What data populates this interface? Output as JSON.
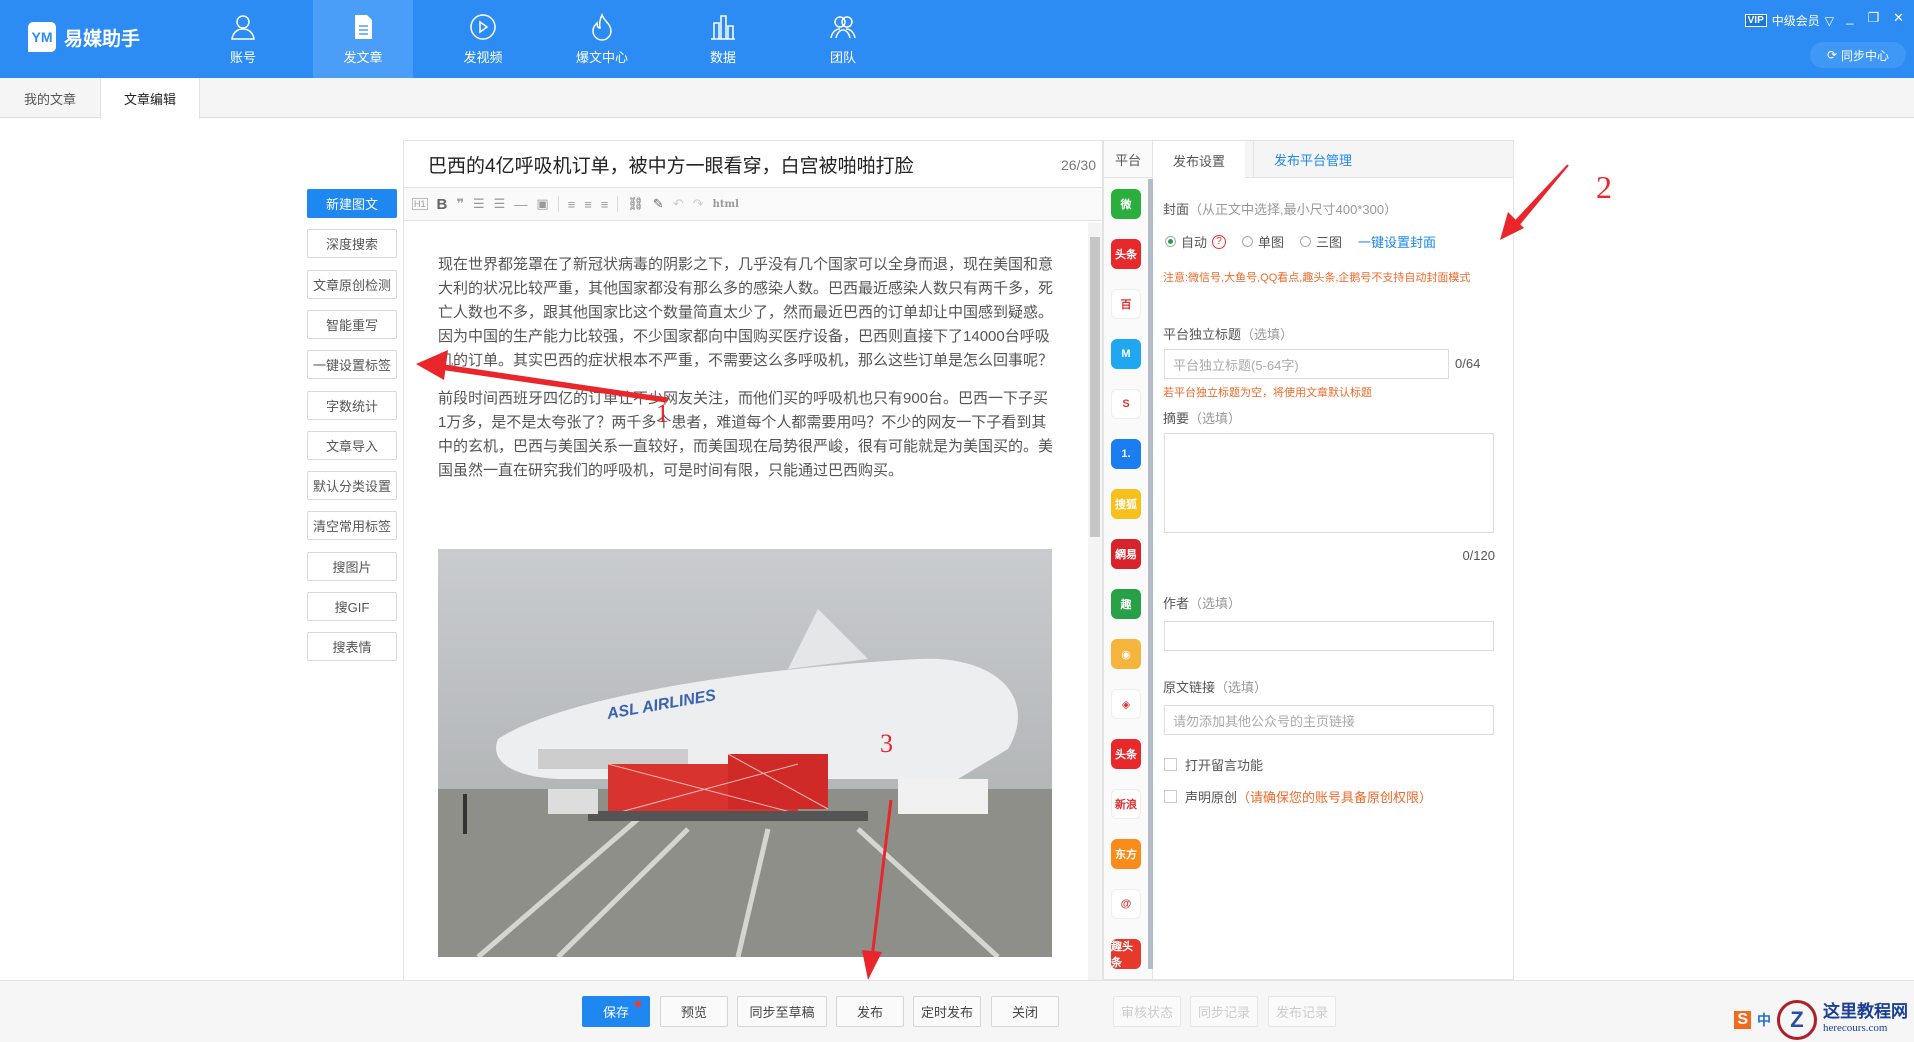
{
  "app": {
    "name": "易媒助手",
    "vip_badge": "VIP",
    "member_level": "中级会员",
    "sync_center": "同步中心"
  },
  "nav": [
    {
      "label": "账号",
      "icon": "user-icon"
    },
    {
      "label": "发文章",
      "icon": "document-icon",
      "active": true
    },
    {
      "label": "发视频",
      "icon": "play-icon"
    },
    {
      "label": "爆文中心",
      "icon": "flame-icon"
    },
    {
      "label": "数据",
      "icon": "bar-chart-icon"
    },
    {
      "label": "团队",
      "icon": "team-icon"
    }
  ],
  "tabs": [
    {
      "label": "我的文章"
    },
    {
      "label": "文章编辑",
      "active": true
    }
  ],
  "tools": [
    "新建图文",
    "深度搜索",
    "文章原创检测",
    "智能重写",
    "一键设置标签",
    "字数统计",
    "文章导入",
    "默认分类设置",
    "清空常用标签",
    "搜图片",
    "搜GIF",
    "搜表情"
  ],
  "editor": {
    "title": "巴西的4亿呼吸机订单，被中方一眼看穿，白宫被啪啪打脸",
    "title_count": "26/30",
    "toolbar_html": "html",
    "paragraphs": [
      "现在世界都笼罩在了新冠状病毒的阴影之下，几乎没有几个国家可以全身而退，现在美国和意大利的状况比较严重，其他国家都没有那么多的感染人数。巴西最近感染人数只有两千多，死亡人数也不多，跟其他国家比这个数量简直太少了，然而最近巴西的订单却让中国感到疑惑。因为中国的生产能力比较强，不少国家都向中国购买医疗设备，巴西则直接下了14000台呼吸机的订单。其实巴西的症状根本不严重，不需要这么多呼吸机，那么这些订单是怎么回事呢？",
      "前段时间西班牙四亿的订单让不少网友关注，而他们买的呼吸机也只有900台。巴西一下子买1万多，是不是太夸张了？两千多个患者，难道每个人都需要用吗？不少的网友一下子看到其中的玄机，巴西与美国关系一直较好，而美国现在局势很严峻，很有可能就是为美国买的。美国虽然一直在研究我们的呼吸机，可是时间有限，只能通过巴西购买。"
    ],
    "image_text": "ASL AIRLINES"
  },
  "platform": {
    "header": "平台",
    "icons": [
      {
        "name": "wechat",
        "glyph": "微",
        "color": "#2aae3d"
      },
      {
        "name": "toutiao",
        "glyph": "头条",
        "color": "#e8292b"
      },
      {
        "name": "baijiahao",
        "glyph": "百",
        "color": "#ffffff"
      },
      {
        "name": "dayu",
        "glyph": "M",
        "color": "#1fa8f0"
      },
      {
        "name": "qiehao",
        "glyph": "S",
        "color": "#ffffff"
      },
      {
        "name": "yidian",
        "glyph": "1.",
        "color": "#1a7ef0"
      },
      {
        "name": "sohu",
        "glyph": "搜狐",
        "color": "#f7c01a"
      },
      {
        "name": "netease",
        "glyph": "網易",
        "color": "#d9232c"
      },
      {
        "name": "qutoutiao",
        "glyph": "趣",
        "color": "#27a046"
      },
      {
        "name": "weibo",
        "glyph": "◉",
        "color": "#f5b53d"
      },
      {
        "name": "aiqiyi",
        "glyph": "◈",
        "color": "#ffffff"
      },
      {
        "name": "toutiao-2",
        "glyph": "头条",
        "color": "#e8292b"
      },
      {
        "name": "sina-kandian",
        "glyph": "新浪",
        "color": "#ffffff"
      },
      {
        "name": "dongfang",
        "glyph": "东方",
        "color": "#f98b1b"
      },
      {
        "name": "fenghuang",
        "glyph": "@",
        "color": "#ffffff"
      },
      {
        "name": "qutoutiao-2",
        "glyph": "趣头条",
        "color": "#e6382b"
      }
    ]
  },
  "settings": {
    "tabs": [
      "发布设置",
      "发布平台管理"
    ],
    "cover_label": "封面",
    "cover_hint": "（从正文中选择,最小尺寸400*300）",
    "cover_options": [
      "自动",
      "单图",
      "三图"
    ],
    "cover_help": "?",
    "cover_one_click": "一键设置封面",
    "cover_warning": "注意:微信号,大鱼号,QQ看点,趣头条,企鹅号不支持自动封面模式",
    "optional": "（选填）",
    "platform_title_label": "平台独立标题",
    "platform_title_placeholder": "平台独立标题(5-64字)",
    "platform_title_count": "0/64",
    "platform_title_warning": "若平台独立标题为空，将使用文章默认标题",
    "summary_label": "摘要",
    "summary_count": "0/120",
    "author_label": "作者",
    "source_label": "原文链接",
    "source_placeholder": "请勿添加其他公众号的主页链接",
    "comment_label": "打开留言功能",
    "original_label": "声明原创",
    "original_hint": "（请确保您的账号具备原创权限）"
  },
  "bottom": {
    "buttons": [
      "保存",
      "预览",
      "同步至草稿",
      "发布",
      "定时发布",
      "关闭"
    ],
    "disabled": [
      "审核状态",
      "同步记录",
      "发布记录"
    ]
  },
  "annotations": [
    "1",
    "2",
    "3"
  ],
  "watermark": {
    "ime": "中",
    "site": "这里教程网",
    "domain": "herecours.com"
  },
  "colors": {
    "brand": "#2c8cf4",
    "annotation": "#e8262b",
    "warning": "#f06a2b"
  }
}
